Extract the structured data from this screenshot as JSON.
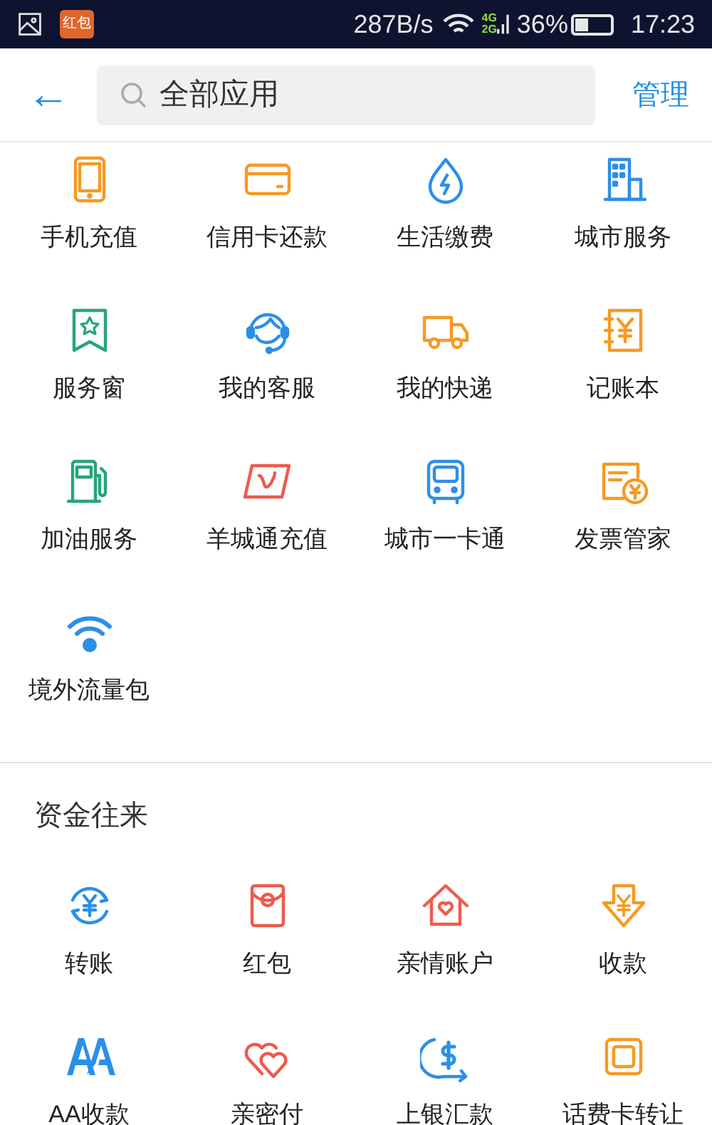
{
  "status_bar": {
    "notification_badge": "红包",
    "speed": "287B/s",
    "network_4g": "4G",
    "network_2g": "2G",
    "battery_text": "36%",
    "time": "17:23"
  },
  "header": {
    "back": "←",
    "search": {
      "value": "全部应用"
    },
    "manage": "管理"
  },
  "sections": [
    {
      "items": [
        {
          "label": "手机充值",
          "color": "#f59a23"
        },
        {
          "label": "信用卡还款",
          "color": "#f59a23"
        },
        {
          "label": "生活缴费",
          "color": "#2b8fe8"
        },
        {
          "label": "城市服务",
          "color": "#2b8fe8"
        },
        {
          "label": "服务窗",
          "color": "#27a57a"
        },
        {
          "label": "我的客服",
          "color": "#2b8fe8"
        },
        {
          "label": "我的快递",
          "color": "#f59a23"
        },
        {
          "label": "记账本",
          "color": "#f59a23"
        },
        {
          "label": "加油服务",
          "color": "#27a57a"
        },
        {
          "label": "羊城通充值",
          "color": "#ef5a4c"
        },
        {
          "label": "城市一卡通",
          "color": "#2b8fe8"
        },
        {
          "label": "发票管家",
          "color": "#f59a23"
        },
        {
          "label": "境外流量包",
          "color": "#2b8fe8"
        }
      ]
    },
    {
      "title": "资金往来",
      "items": [
        {
          "label": "转账",
          "color": "#2b8fe8"
        },
        {
          "label": "红包",
          "color": "#ef5a4c"
        },
        {
          "label": "亲情账户",
          "color": "#ef5a4c"
        },
        {
          "label": "收款",
          "color": "#f59a23"
        },
        {
          "label": "AA收款",
          "color": "#2b8fe8"
        },
        {
          "label": "亲密付",
          "color": "#ef5a4c"
        },
        {
          "label": "上银汇款",
          "color": "#2b8fe8"
        },
        {
          "label": "话费卡转让",
          "color": "#f59a23"
        }
      ]
    }
  ]
}
